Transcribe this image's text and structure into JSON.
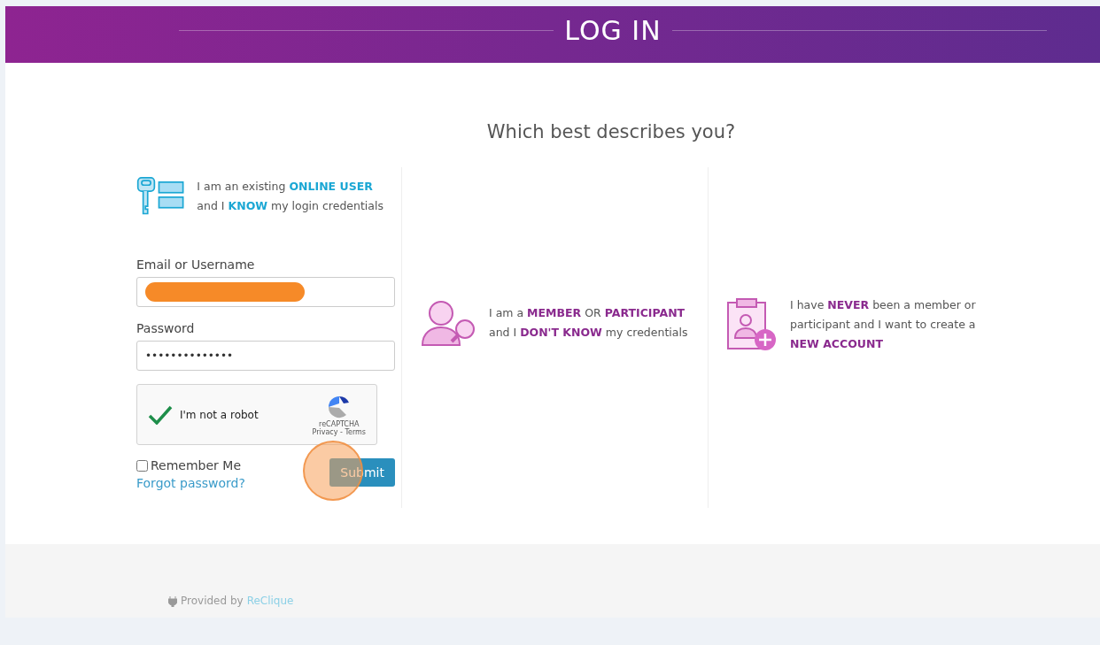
{
  "header": {
    "title": "LOG IN"
  },
  "question": "Which best describes you?",
  "options": [
    {
      "kind": "login",
      "text": "I am an existing **ONLINE USER**\nand I **KNOW** my login credentials"
    },
    {
      "kind": "member",
      "text": "I am a **MEMBER** OR **PARTICIPANT**\nand I **DON'T KNOW** my credentials"
    },
    {
      "kind": "new",
      "text": "I have **NEVER** been a member or\nparticipant and I want to create a\n**NEW ACCOUNT**"
    }
  ],
  "form": {
    "email": {
      "label": "Email or Username",
      "redacted": true
    },
    "password": {
      "label": "Password",
      "value": "••••••••••••••"
    },
    "captcha": {
      "label": "I'm not a robot",
      "checked": true,
      "brand": "reCAPTCHA",
      "links": "Privacy - Terms"
    },
    "remember": {
      "label": "Remember Me",
      "checked": false
    },
    "forgot": "Forgot password?",
    "submit": "Submit",
    "clicked": true
  },
  "footer": {
    "text": "Provided by",
    "link": "ReClique"
  }
}
